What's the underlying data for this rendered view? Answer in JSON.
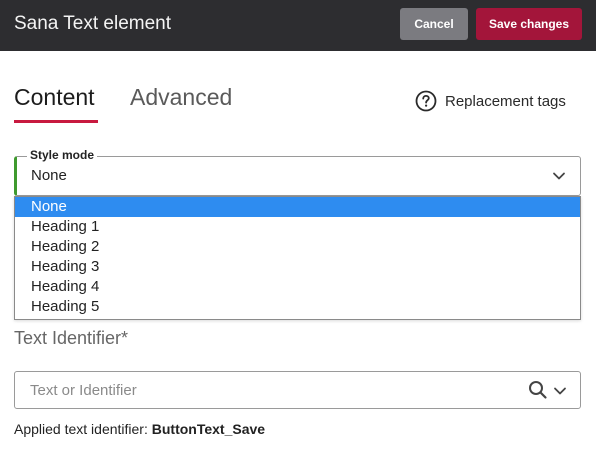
{
  "window": {
    "title": "Sana Text element",
    "cancel_label": "Cancel",
    "save_label": "Save changes"
  },
  "tabs": [
    {
      "label": "Content",
      "active": true
    },
    {
      "label": "Advanced",
      "active": false
    }
  ],
  "replacement_tags": {
    "label": "Replacement tags",
    "icon": "help-circle-icon"
  },
  "style_mode": {
    "label": "Style mode",
    "value": "None",
    "options": [
      "None",
      "Heading 1",
      "Heading 2",
      "Heading 3",
      "Heading 4",
      "Heading 5"
    ],
    "selected_index": 0
  },
  "text_identifier": {
    "label": "Text Identifier*",
    "placeholder": "Text or Identifier",
    "applied_prefix": "Applied text identifier:",
    "applied_value": "ButtonText_Save"
  },
  "colors": {
    "titlebar": "#2d2d30",
    "save_button": "#a3153a",
    "cancel_button": "#7b7b80",
    "tab_underline": "#c8193f",
    "selected_option": "#2e8cf0",
    "focus_accent": "#3f9a2f"
  }
}
